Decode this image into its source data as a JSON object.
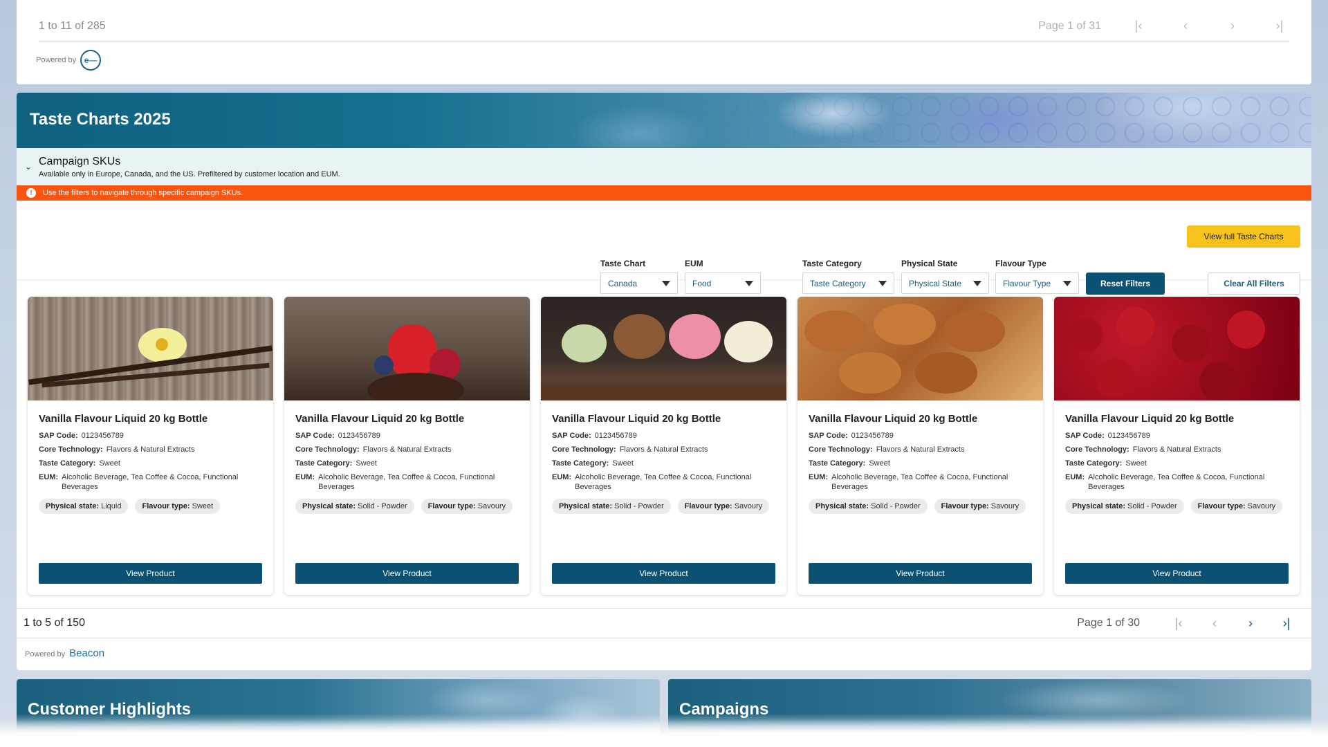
{
  "top_pager": {
    "count": "1 to 11 of 285",
    "page": "Page 1 of 31",
    "powered_by": "Powered by"
  },
  "banner": {
    "title": "Taste Charts 2025"
  },
  "campaign": {
    "title": "Campaign SKUs",
    "subtitle": "Available only in Europe, Canada, and the US. Prefiltered by customer location and EUM."
  },
  "alert": {
    "text": "Use the filters to navigate through specific campaign SKUs."
  },
  "actions": {
    "view_full": "View full Taste Charts",
    "reset": "Reset Filters",
    "clear": "Clear All Filters"
  },
  "filters": {
    "taste_chart": {
      "label": "Taste Chart",
      "value": "Canada"
    },
    "eum": {
      "label": "EUM",
      "value": "Food"
    },
    "taste_category": {
      "label": "Taste Category",
      "value": "Taste Category"
    },
    "physical_state": {
      "label": "Physical State",
      "value": "Physical State"
    },
    "flavour_type": {
      "label": "Flavour Type",
      "value": "Flavour Type"
    }
  },
  "labels": {
    "sap": "SAP Code:",
    "core": "Core Technology:",
    "taste": "Taste Category:",
    "eum": "EUM:",
    "physical": "Physical state:",
    "flavour": "Flavour type:",
    "view": "View Product"
  },
  "products": [
    {
      "title": "Vanilla Flavour Liquid 20 kg Bottle",
      "sap": "0123456789",
      "core": "Flavors & Natural Extracts",
      "taste": "Sweet",
      "eum": "Alcoholic Beverage, Tea Coffee & Cocoa, Functional Beverages",
      "physical": "Liquid",
      "flavour": "Sweet",
      "image": "vanilla-image"
    },
    {
      "title": "Vanilla Flavour Liquid 20 kg Bottle",
      "sap": "0123456789",
      "core": "Flavors & Natural Extracts",
      "taste": "Sweet",
      "eum": "Alcoholic Beverage, Tea Coffee & Cocoa, Functional Beverages",
      "physical": "Solid - Powder",
      "flavour": "Savoury",
      "image": "strawberry-image"
    },
    {
      "title": "Vanilla Flavour Liquid 20 kg Bottle",
      "sap": "0123456789",
      "core": "Flavors & Natural Extracts",
      "taste": "Sweet",
      "eum": "Alcoholic Beverage, Tea Coffee & Cocoa, Functional Beverages",
      "physical": "Solid - Powder",
      "flavour": "Savoury",
      "image": "ice-cream-image"
    },
    {
      "title": "Vanilla Flavour Liquid 20 kg Bottle",
      "sap": "0123456789",
      "core": "Flavors & Natural Extracts",
      "taste": "Sweet",
      "eum": "Alcoholic Beverage, Tea Coffee & Cocoa, Functional Beverages",
      "physical": "Solid - Powder",
      "flavour": "Savoury",
      "image": "pastry-image"
    },
    {
      "title": "Vanilla Flavour Liquid 20 kg Bottle",
      "sap": "0123456789",
      "core": "Flavors & Natural Extracts",
      "taste": "Sweet",
      "eum": "Alcoholic Beverage, Tea Coffee & Cocoa, Functional Beverages",
      "physical": "Solid - Powder",
      "flavour": "Savoury",
      "image": "cherry-image"
    }
  ],
  "bottom_pager": {
    "count": "1 to 5 of 150",
    "page": "Page 1 of 30",
    "powered_by": "Powered by",
    "brand": "Beacon"
  },
  "sections": {
    "customer_highlights": "Customer Highlights",
    "campaigns": "Campaigns"
  },
  "colors": {
    "primary": "#0b5173",
    "accent_yellow": "#f6c21b",
    "alert_orange": "#fa5510",
    "campaign_bg": "#e8f3f5"
  }
}
